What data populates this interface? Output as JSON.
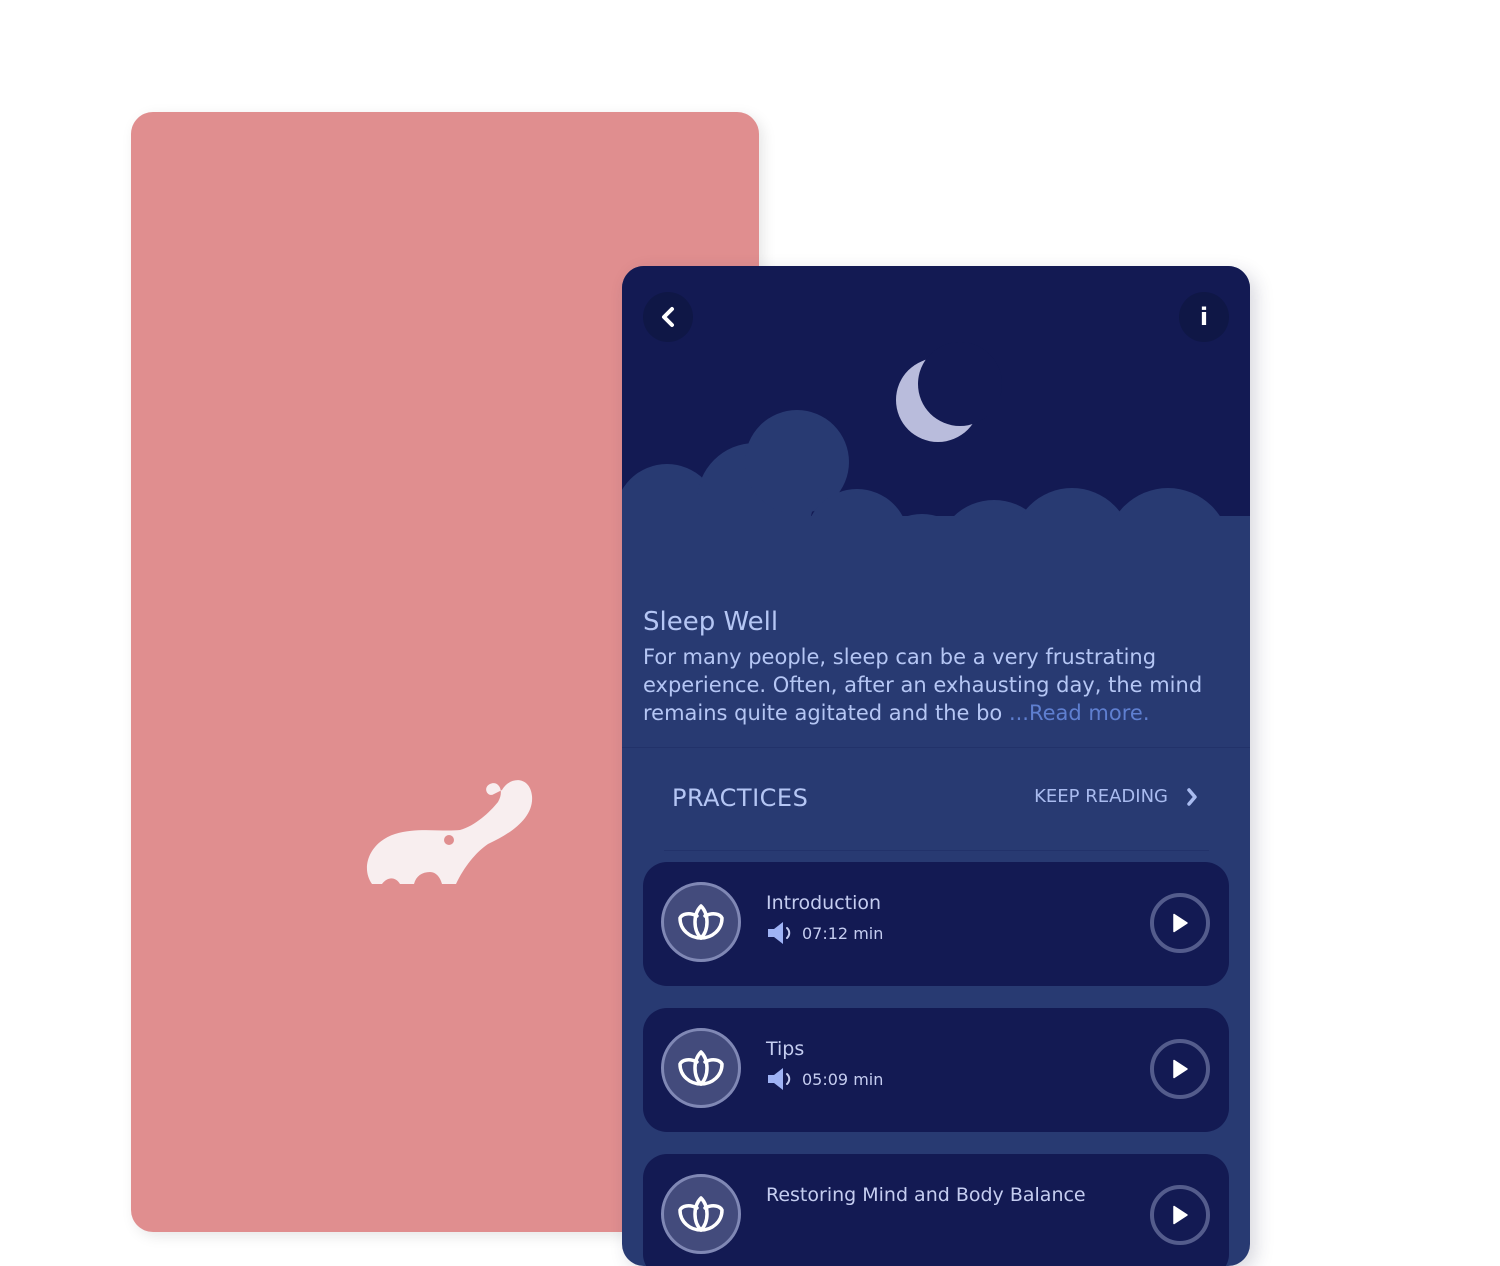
{
  "colors": {
    "pink_card": "#e08e8f",
    "night_sky": "#131a53",
    "cloud": "#283a72",
    "text_primary": "#b5c6f4",
    "link": "#5f7fd0",
    "card": "#131a53"
  },
  "left_card": {
    "logo_icon": "elephant-icon"
  },
  "header": {
    "back_icon": "chevron-left-icon",
    "info_label": "i",
    "moon_icon": "crescent-moon-icon"
  },
  "content": {
    "title": "Sleep Well",
    "description": "For many people, sleep can be a very frustrating experience. Often, after an exhausting day, the mind remains quite agitated and the bo",
    "read_more": " ...Read more."
  },
  "practices_section": {
    "title": "PRACTICES",
    "keep_reading": "KEEP READING",
    "keep_reading_icon": "chevron-right-icon"
  },
  "practices": [
    {
      "title": "Introduction",
      "duration": "07:12 min",
      "icon": "lotus-icon",
      "audio_icon": "speaker-icon",
      "action_icon": "play-icon"
    },
    {
      "title": "Tips",
      "duration": "05:09 min",
      "icon": "lotus-icon",
      "audio_icon": "speaker-icon",
      "action_icon": "play-icon"
    },
    {
      "title": "Restoring Mind and Body Balance",
      "duration": "",
      "icon": "lotus-icon",
      "audio_icon": "speaker-icon",
      "action_icon": "play-icon"
    }
  ]
}
